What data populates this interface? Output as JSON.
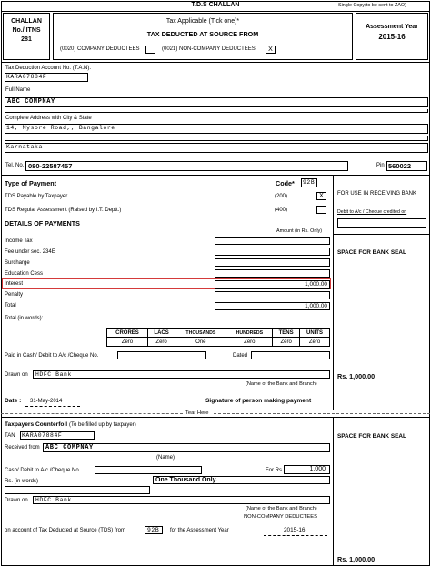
{
  "header": {
    "title": "T.D.S CHALLAN",
    "copy_note": "Single Copy(to be sent to ZAO)",
    "challan_no_line1": "CHALLAN",
    "challan_no_line2": "No./ ITNS",
    "challan_no_line3": "281",
    "tax_applicable": "Tax Applicable (Tick one)*",
    "tds_from": "TAX DEDUCTED AT SOURCE FROM",
    "company_opt": "(0020) COMPANY DEDUCTEES",
    "noncompany_opt": "(0021) NON-COMPANY DEDUCTEES",
    "noncompany_mark": "X",
    "assessment_label": "Assessment Year",
    "assessment_value": "2015-16"
  },
  "deductor": {
    "tan_label": "Tax Deduction Account No. (T.A.N).",
    "tan_value": "KARA07884F",
    "name_label": "Full Name",
    "name_value": "ABC COMPNAY",
    "address_label": "Complete Address with City & State",
    "address_line1": "14, Mysore Road,, Bangalore",
    "address_line2": "Karnataka",
    "tel_label": "Tel. No.",
    "tel_value": "080-22587457",
    "pin_label": "Pin",
    "pin_value": "560022"
  },
  "payment": {
    "type_label": "Type of Payment",
    "code_label": "Code*",
    "code_value": "92B",
    "tds_payable_label": "TDS Payable by Taxpayer",
    "tds_payable_code": "(200)",
    "tds_payable_mark": "X",
    "tds_regular_label": "TDS Regular Assessment (Raised by I.T. Deptt.)",
    "tds_regular_code": "(400)",
    "details_label": "DETAILS OF PAYMENTS",
    "amount_label": "Amount (in Rs. Only)",
    "rows": [
      {
        "label": "Income Tax",
        "value": ""
      },
      {
        "label": "Fee under sec. 234E",
        "value": ""
      },
      {
        "label": "Surcharge",
        "value": ""
      },
      {
        "label": "Education Cess",
        "value": ""
      },
      {
        "label": "Interest",
        "value": "1,000.00"
      },
      {
        "label": "Penalty",
        "value": ""
      },
      {
        "label": "Total",
        "value": "1,000.00"
      }
    ],
    "total_words_label": "Total (in words):",
    "units_headers": [
      "CRORES",
      "LACS",
      "THOUSANDS",
      "HUNDREDS",
      "TENS",
      "UNITS"
    ],
    "units_values": [
      "Zero",
      "Zero",
      "One",
      "Zero",
      "Zero",
      "Zero"
    ],
    "paid_label": "Paid in Cash/ Debit to A/c /Cheque No.",
    "dated_label": "Dated",
    "drawn_label": "Drawn on",
    "drawn_value": "HDFC Bank",
    "bank_branch_label": "(Name of the Bank and Branch)",
    "date_label": "Date :",
    "date_value": "31-May-2014",
    "signature_label": "Signature of person making payment"
  },
  "bank_use": {
    "receiving_label": "FOR USE IN RECEIVING BANK",
    "debit_label": "Debit to A/c / Cheque credited on",
    "seal_label": "SPACE FOR BANK SEAL",
    "amount": "Rs. 1,000.00"
  },
  "tear": {
    "label": "Tear Here"
  },
  "counterfoil": {
    "title": "Taxpayers Counterfoil",
    "subtitle": "(To be filled up by taxpayer)",
    "tan_label": "TAN",
    "tan_value": "KARA07884F",
    "received_label": "Received from",
    "received_value": "ABC COMPNAY",
    "name_label": "(Name)",
    "cash_label": "Cash/ Debit to A/c /Cheque No.",
    "for_rs_label": "For Rs.",
    "for_rs_value": "1,000",
    "rs_words_label": "Rs. (in words)",
    "rs_words_value": "One Thousand Only.",
    "drawn_label": "Drawn on",
    "drawn_value": "HDFC Bank",
    "bank_branch_label": "(Name of the Bank and Branch)",
    "noncompany_label": "NON-COMPANY DEDUCTEES",
    "account_label": "on account of Tax Deducted at Source (TDS) from",
    "account_code": "92B",
    "assessment_label": "for the Assessment Year",
    "assessment_value": "2015-16",
    "seal_label": "SPACE FOR BANK SEAL",
    "amount": "Rs. 1,000.00"
  }
}
